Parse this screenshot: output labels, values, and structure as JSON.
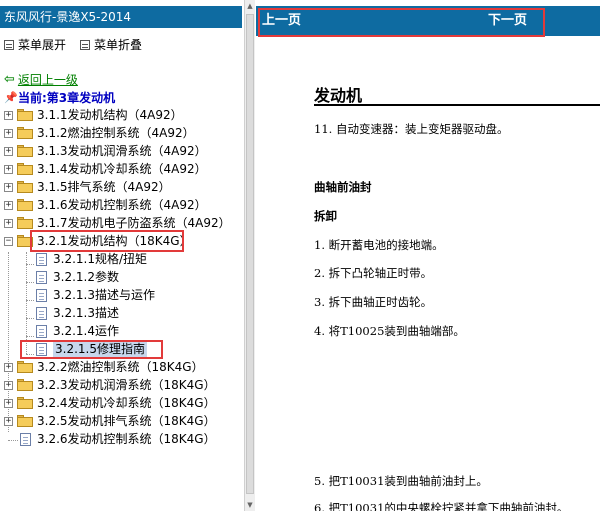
{
  "left": {
    "title": "东风风行-景逸X5-2014",
    "menu": {
      "expand": "菜单展开",
      "collapse": "菜单折叠"
    },
    "back": "返回上一级",
    "current": "当前:第3章发动机",
    "tree": [
      {
        "label": "3.1.1发动机结构（4A92）",
        "state": "collapsed"
      },
      {
        "label": "3.1.2燃油控制系统（4A92）",
        "state": "collapsed"
      },
      {
        "label": "3.1.3发动机润滑系统（4A92）",
        "state": "collapsed"
      },
      {
        "label": "3.1.4发动机冷却系统（4A92）",
        "state": "collapsed"
      },
      {
        "label": "3.1.5排气系统（4A92）",
        "state": "collapsed"
      },
      {
        "label": "3.1.6发动机控制系统（4A92）",
        "state": "collapsed"
      },
      {
        "label": "3.1.7发动机电子防盗系统（4A92）",
        "state": "collapsed"
      },
      {
        "label": "3.2.1发动机结构（18K4G）",
        "state": "expanded"
      },
      {
        "label": "3.2.1.1规格/扭矩",
        "state": "leaf"
      },
      {
        "label": "3.2.1.2参数",
        "state": "leaf"
      },
      {
        "label": "3.2.1.3描述与运作",
        "state": "leaf"
      },
      {
        "label": "3.2.1.3描述",
        "state": "leaf"
      },
      {
        "label": "3.2.1.4运作",
        "state": "leaf"
      },
      {
        "label": "3.2.1.5修理指南",
        "state": "leaf-selected"
      },
      {
        "label": "3.2.2燃油控制系统（18K4G）",
        "state": "collapsed"
      },
      {
        "label": "3.2.3发动机润滑系统（18K4G）",
        "state": "collapsed"
      },
      {
        "label": "3.2.4发动机冷却系统（18K4G）",
        "state": "collapsed"
      },
      {
        "label": "3.2.5发动机排气系统（18K4G）",
        "state": "collapsed"
      },
      {
        "label": "3.2.6发动机控制系统（18K4G）",
        "state": "leaf-root"
      }
    ]
  },
  "right": {
    "prev": "上一页",
    "next": "下一页",
    "title": "发动机",
    "lines": [
      "11.  自动变速器：装上变矩器驱动盘。",
      "曲轴前油封",
      "拆卸",
      "1.  断开蓄电池的接地端。",
      "2.  拆下凸轮轴正时带。",
      "3.  拆下曲轴正时齿轮。",
      "4.  将T10025装到曲轴端部。",
      "5.  把T10031装到曲轴前油封上。",
      "6.  把T10031的中央螺栓拧紧并拿下曲轴前油封。"
    ]
  }
}
